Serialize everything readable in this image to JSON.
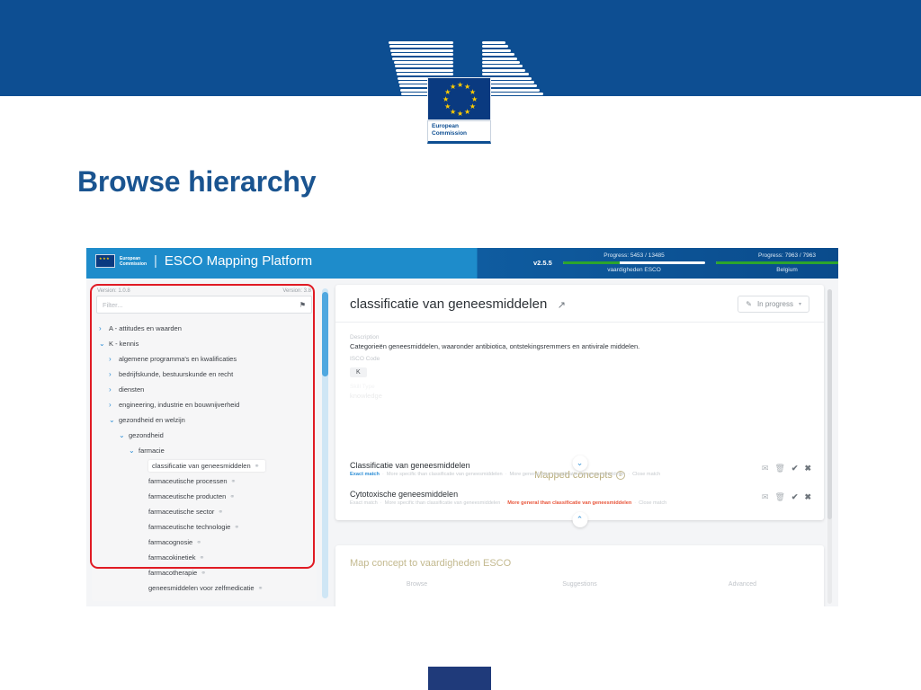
{
  "slide": {
    "title": "Browse hierarchy",
    "brand_name_line1": "European",
    "brand_name_line2": "Commission"
  },
  "app_header": {
    "ec_line1": "European",
    "ec_line2": "Commission",
    "separator": "|",
    "app_title": "ESCO Mapping Platform",
    "version": "v2.5.5",
    "help_icon": "?",
    "user_icon": "◉",
    "progress": [
      {
        "label": "Progress: 5453 / 13485",
        "sublabel": "vaardigheden ESCO",
        "percent": 40
      },
      {
        "label": "Progress: 7963 / 7963",
        "sublabel": "Belgium",
        "percent": 100
      }
    ]
  },
  "sidebar": {
    "version_left": "Version: 1.0.8",
    "version_right": "Version: 3.8",
    "filter_placeholder": "Filter...",
    "filter_icon": "⚑",
    "tree": [
      {
        "label": "A - attitudes en waarden",
        "indent": 0,
        "toggle": "›",
        "chain": false,
        "selected": false
      },
      {
        "label": "K - kennis",
        "indent": 0,
        "toggle": "⌄",
        "chain": false,
        "selected": false
      },
      {
        "label": "algemene programma's en kwalificaties",
        "indent": 1,
        "toggle": "›",
        "chain": false,
        "selected": false
      },
      {
        "label": "bedrijfskunde, bestuurskunde en recht",
        "indent": 1,
        "toggle": "›",
        "chain": false,
        "selected": false
      },
      {
        "label": "diensten",
        "indent": 1,
        "toggle": "›",
        "chain": false,
        "selected": false
      },
      {
        "label": "engineering, industrie en bouwnijverheid",
        "indent": 1,
        "toggle": "›",
        "chain": false,
        "selected": false
      },
      {
        "label": "gezondheid en welzijn",
        "indent": 1,
        "toggle": "⌄",
        "chain": false,
        "selected": false
      },
      {
        "label": "gezondheid",
        "indent": 2,
        "toggle": "⌄",
        "chain": false,
        "selected": false
      },
      {
        "label": "farmacie",
        "indent": 3,
        "toggle": "⌄",
        "chain": false,
        "selected": false
      },
      {
        "label": "classificatie van geneesmiddelen",
        "indent": 4,
        "toggle": "",
        "chain": true,
        "selected": true
      },
      {
        "label": "farmaceutische processen",
        "indent": 4,
        "toggle": "",
        "chain": true,
        "selected": false
      },
      {
        "label": "farmaceutische producten",
        "indent": 4,
        "toggle": "",
        "chain": true,
        "selected": false
      },
      {
        "label": "farmaceutische sector",
        "indent": 4,
        "toggle": "",
        "chain": true,
        "selected": false
      },
      {
        "label": "farmaceutische technologie",
        "indent": 4,
        "toggle": "",
        "chain": true,
        "selected": false
      },
      {
        "label": "farmacognosie",
        "indent": 4,
        "toggle": "",
        "chain": true,
        "selected": false
      },
      {
        "label": "farmacokinetiek",
        "indent": 4,
        "toggle": "",
        "chain": true,
        "selected": false
      },
      {
        "label": "farmacotherapie",
        "indent": 4,
        "toggle": "",
        "chain": true,
        "selected": false
      },
      {
        "label": "geneesmiddelen voor zelfmedicatie",
        "indent": 4,
        "toggle": "",
        "chain": true,
        "selected": false
      }
    ]
  },
  "concept": {
    "title": "classificatie van geneesmiddelen",
    "external_icon": "↗",
    "status_label": "In progress",
    "status_pencil": "✎",
    "status_caret": "▾",
    "description_label": "Description",
    "description_value": "Categorieën geneesmiddelen, waaronder antibiotica, ontstekingsremmers en antivirale middelen.",
    "isco_label": "ISCO Code",
    "isco_value": "K",
    "skilltype_label": "Skill Type",
    "skilltype_value": "knowledge",
    "collapse_down_icon": "⌄",
    "collapse_up_icon": "⌃"
  },
  "mapped": {
    "heading": "Mapped concepts",
    "count": "2",
    "rows": [
      {
        "name": "Classificatie van geneesmiddelen",
        "options": [
          {
            "text": "Exact match",
            "state": "blue"
          },
          {
            "text": "More specific than classificatie van geneesmiddelen",
            "state": "off"
          },
          {
            "text": "More general than classificatie van geneesmiddelen",
            "state": "off"
          },
          {
            "text": "Close match",
            "state": "off"
          }
        ],
        "icons": [
          "✉",
          "🗑",
          "✔",
          "✖"
        ]
      },
      {
        "name": "Cytotoxische geneesmiddelen",
        "options": [
          {
            "text": "Exact match",
            "state": "off"
          },
          {
            "text": "More specific than classificatie van geneesmiddelen",
            "state": "off"
          },
          {
            "text": "More general than classificatie van geneesmiddelen",
            "state": "red"
          },
          {
            "text": "Close match",
            "state": "off"
          }
        ],
        "icons": [
          "✉",
          "🗑",
          "✔",
          "✖"
        ]
      }
    ]
  },
  "map_panel": {
    "title": "Map concept to vaardigheden ESCO",
    "tabs": [
      "Browse",
      "Suggestions",
      "Advanced"
    ]
  },
  "colors": {
    "eu_blue": "#0d4e92",
    "app_header_blue": "#1e8ccb",
    "accent_blue": "#2f8fd6",
    "progress_green": "#2ca52c",
    "highlight_red": "#e01b24",
    "gold": "#c3b98f",
    "error_red": "#e8553a"
  }
}
